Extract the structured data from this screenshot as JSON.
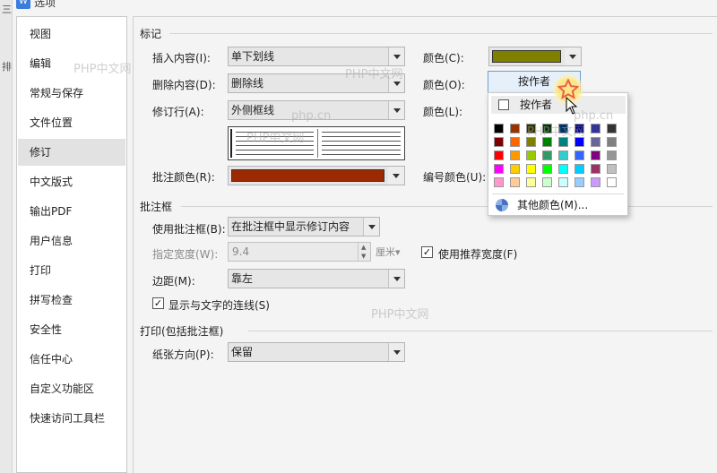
{
  "window": {
    "title": "选项",
    "app_icon": "wps-writer-icon"
  },
  "left_strip": [
    "三",
    "排"
  ],
  "sidebar": {
    "items": [
      {
        "label": "视图",
        "active": false
      },
      {
        "label": "编辑",
        "active": false
      },
      {
        "label": "常规与保存",
        "active": false
      },
      {
        "label": "文件位置",
        "active": false
      },
      {
        "label": "修订",
        "active": true
      },
      {
        "label": "中文版式",
        "active": false
      },
      {
        "label": "输出PDF",
        "active": false
      },
      {
        "label": "用户信息",
        "active": false
      },
      {
        "label": "打印",
        "active": false
      },
      {
        "label": "拼写检查",
        "active": false
      },
      {
        "label": "安全性",
        "active": false
      },
      {
        "label": "信任中心",
        "active": false
      },
      {
        "label": "自定义功能区",
        "active": false
      },
      {
        "label": "快速访问工具栏",
        "active": false
      }
    ]
  },
  "markup": {
    "section_title": "标记",
    "insert_label": "插入内容(I):",
    "insert_value": "单下划线",
    "insert_color_label": "颜色(C):",
    "insert_color": "#7f7f00",
    "delete_label": "删除内容(D):",
    "delete_value": "删除线",
    "delete_color_label": "颜色(O):",
    "delete_color_value": "按作者",
    "revline_label": "修订行(A):",
    "revline_value": "外侧框线",
    "revline_color_label": "颜色(L):",
    "comment_color_label": "批注颜色(R):",
    "comment_color": "#9c2a00",
    "number_color_label": "编号颜色(U):"
  },
  "balloon": {
    "section_title": "批注框",
    "use_label": "使用批注框(B):",
    "use_value": "在批注框中显示修订内容",
    "width_label": "指定宽度(W):",
    "width_value": "9.4",
    "width_unit": "厘米",
    "recommend_label": "使用推荐宽度(F)",
    "recommend_checked": true,
    "margin_label": "边距(M):",
    "margin_value": "靠左",
    "lines_label": "显示与文字的连线(S)",
    "lines_checked": true
  },
  "print": {
    "section_title": "打印(包括批注框)",
    "orientation_label": "纸张方向(P):",
    "orientation_value": "保留"
  },
  "color_popup": {
    "by_author": "按作者",
    "more_colors": "其他颜色(M)...",
    "more_colors_underline": "M",
    "colors": [
      [
        "#000000",
        "#993300",
        "#333300",
        "#003300",
        "#003366",
        "#000080",
        "#333399",
        "#333333"
      ],
      [
        "#800000",
        "#ff6600",
        "#808000",
        "#008000",
        "#008080",
        "#0000ff",
        "#666699",
        "#808080"
      ],
      [
        "#ff0000",
        "#ff9900",
        "#99cc00",
        "#339966",
        "#33cccc",
        "#3366ff",
        "#800080",
        "#969696"
      ],
      [
        "#ff00ff",
        "#ffcc00",
        "#ffff00",
        "#00ff00",
        "#00ffff",
        "#00ccff",
        "#993366",
        "#c0c0c0"
      ],
      [
        "#ff99cc",
        "#ffcc99",
        "#ffff99",
        "#ccffcc",
        "#ccffff",
        "#99ccff",
        "#cc99ff",
        "#ffffff"
      ]
    ]
  },
  "watermarks": [
    "PHP中文网",
    "PHP中文网",
    "PHP中文网",
    "php.cn",
    "PHP中文网",
    "php.cn",
    "PHP中文网"
  ]
}
